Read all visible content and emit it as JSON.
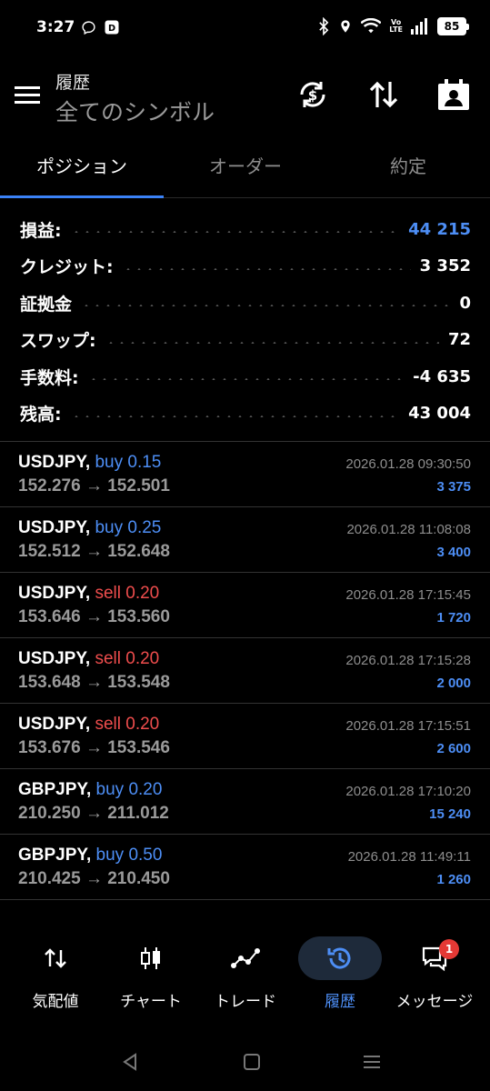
{
  "status_bar": {
    "time": "3:27",
    "battery": "85",
    "network_label_top": "Vo",
    "network_label_bottom": "LTE",
    "icons": [
      "chat-bubble-icon",
      "notification-app-icon",
      "bluetooth-icon",
      "location-icon",
      "wifi-icon",
      "signal-icon",
      "battery-icon"
    ]
  },
  "header": {
    "title": "履歴",
    "subtitle": "全てのシンボル",
    "icons": [
      "menu-icon",
      "sync-currency-icon",
      "sort-icon",
      "calendar-person-icon"
    ]
  },
  "tabs": [
    {
      "label": "ポジション",
      "active": true
    },
    {
      "label": "オーダー",
      "active": false
    },
    {
      "label": "約定",
      "active": false
    }
  ],
  "summary": [
    {
      "label": "損益:",
      "value": "44 215",
      "highlight": true
    },
    {
      "label": "クレジット:",
      "value": "3 352",
      "highlight": false
    },
    {
      "label": "証拠金",
      "value": "0",
      "highlight": false
    },
    {
      "label": "スワップ:",
      "value": "72",
      "highlight": false
    },
    {
      "label": "手数料:",
      "value": "-4 635",
      "highlight": false
    },
    {
      "label": "残高:",
      "value": "43 004",
      "highlight": false
    }
  ],
  "trades": [
    {
      "symbol": "USDJPY,",
      "side": "buy 0.15",
      "type": "buy",
      "prices": "152.276 → 152.501",
      "datetime": "2026.01.28 09:30:50",
      "profit": "3 375"
    },
    {
      "symbol": "USDJPY,",
      "side": "buy 0.25",
      "type": "buy",
      "prices": "152.512 → 152.648",
      "datetime": "2026.01.28 11:08:08",
      "profit": "3 400"
    },
    {
      "symbol": "USDJPY,",
      "side": "sell 0.20",
      "type": "sell",
      "prices": "153.646 → 153.560",
      "datetime": "2026.01.28 17:15:45",
      "profit": "1 720"
    },
    {
      "symbol": "USDJPY,",
      "side": "sell 0.20",
      "type": "sell",
      "prices": "153.648 → 153.548",
      "datetime": "2026.01.28 17:15:28",
      "profit": "2 000"
    },
    {
      "symbol": "USDJPY,",
      "side": "sell 0.20",
      "type": "sell",
      "prices": "153.676 → 153.546",
      "datetime": "2026.01.28 17:15:51",
      "profit": "2 600"
    },
    {
      "symbol": "GBPJPY,",
      "side": "buy 0.20",
      "type": "buy",
      "prices": "210.250 → 211.012",
      "datetime": "2026.01.28 17:10:20",
      "profit": "15 240"
    },
    {
      "symbol": "GBPJPY,",
      "side": "buy 0.50",
      "type": "buy",
      "prices": "210.425 → 210.450",
      "datetime": "2026.01.28 11:49:11",
      "profit": "1 260"
    }
  ],
  "bottom_nav": [
    {
      "label": "気配値",
      "icon": "quotes-icon",
      "active": false
    },
    {
      "label": "チャート",
      "icon": "chart-icon",
      "active": false
    },
    {
      "label": "トレード",
      "icon": "trade-icon",
      "active": false
    },
    {
      "label": "履歴",
      "icon": "history-icon",
      "active": true
    },
    {
      "label": "メッセージ",
      "icon": "messages-icon",
      "active": false,
      "badge": "1"
    }
  ],
  "colors": {
    "accent": "#4d8ef5",
    "sell": "#ef4d4d",
    "background": "#000000"
  }
}
